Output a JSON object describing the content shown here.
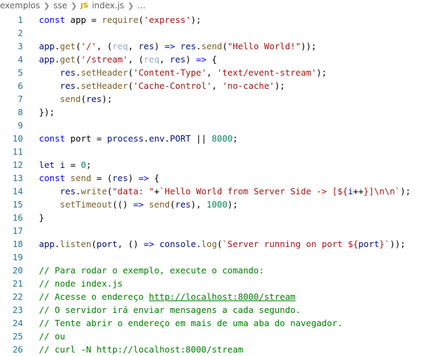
{
  "breadcrumb": {
    "items": [
      "exemplos",
      "sse",
      "index.js",
      "..."
    ],
    "file_icon": "JS"
  },
  "lines": [
    {
      "n": "1",
      "tokens": [
        {
          "t": "const",
          "c": "kw"
        },
        {
          "t": " app = ",
          "c": "plain"
        },
        {
          "t": "require",
          "c": "fn"
        },
        {
          "t": "(",
          "c": "plain"
        },
        {
          "t": "'express'",
          "c": "str"
        },
        {
          "t": ");",
          "c": "plain"
        }
      ]
    },
    {
      "n": "2",
      "tokens": []
    },
    {
      "n": "3",
      "tokens": [
        {
          "t": "app",
          "c": "var"
        },
        {
          "t": ".",
          "c": "plain"
        },
        {
          "t": "get",
          "c": "fn"
        },
        {
          "t": "(",
          "c": "plain"
        },
        {
          "t": "'/'",
          "c": "str"
        },
        {
          "t": ", (",
          "c": "plain"
        },
        {
          "t": "req",
          "c": "unused"
        },
        {
          "t": ", ",
          "c": "plain"
        },
        {
          "t": "res",
          "c": "param"
        },
        {
          "t": ") ",
          "c": "plain"
        },
        {
          "t": "=>",
          "c": "kw"
        },
        {
          "t": " ",
          "c": "plain"
        },
        {
          "t": "res",
          "c": "param"
        },
        {
          "t": ".",
          "c": "plain"
        },
        {
          "t": "send",
          "c": "fn"
        },
        {
          "t": "(",
          "c": "plain"
        },
        {
          "t": "\"Hello World!\"",
          "c": "str"
        },
        {
          "t": "));",
          "c": "plain"
        }
      ]
    },
    {
      "n": "4",
      "tokens": [
        {
          "t": "app",
          "c": "var"
        },
        {
          "t": ".",
          "c": "plain"
        },
        {
          "t": "get",
          "c": "fn"
        },
        {
          "t": "(",
          "c": "plain"
        },
        {
          "t": "'/stream'",
          "c": "str"
        },
        {
          "t": ", (",
          "c": "plain"
        },
        {
          "t": "req",
          "c": "unused"
        },
        {
          "t": ", ",
          "c": "plain"
        },
        {
          "t": "res",
          "c": "param"
        },
        {
          "t": ") ",
          "c": "plain"
        },
        {
          "t": "=>",
          "c": "kw"
        },
        {
          "t": " {",
          "c": "plain"
        }
      ]
    },
    {
      "n": "5",
      "tokens": [
        {
          "t": "    ",
          "c": "plain"
        },
        {
          "t": "res",
          "c": "param"
        },
        {
          "t": ".",
          "c": "plain"
        },
        {
          "t": "setHeader",
          "c": "fn"
        },
        {
          "t": "(",
          "c": "plain"
        },
        {
          "t": "'Content-Type'",
          "c": "str"
        },
        {
          "t": ", ",
          "c": "plain"
        },
        {
          "t": "'text/event-stream'",
          "c": "str"
        },
        {
          "t": ");",
          "c": "plain"
        }
      ]
    },
    {
      "n": "6",
      "tokens": [
        {
          "t": "    ",
          "c": "plain"
        },
        {
          "t": "res",
          "c": "param"
        },
        {
          "t": ".",
          "c": "plain"
        },
        {
          "t": "setHeader",
          "c": "fn"
        },
        {
          "t": "(",
          "c": "plain"
        },
        {
          "t": "'Cache-Control'",
          "c": "str"
        },
        {
          "t": ", ",
          "c": "plain"
        },
        {
          "t": "'no-cache'",
          "c": "str"
        },
        {
          "t": ");",
          "c": "plain"
        }
      ]
    },
    {
      "n": "7",
      "tokens": [
        {
          "t": "    ",
          "c": "plain"
        },
        {
          "t": "send",
          "c": "fn"
        },
        {
          "t": "(",
          "c": "plain"
        },
        {
          "t": "res",
          "c": "param"
        },
        {
          "t": ");",
          "c": "plain"
        }
      ]
    },
    {
      "n": "8",
      "tokens": [
        {
          "t": "});",
          "c": "plain"
        }
      ]
    },
    {
      "n": "9",
      "tokens": []
    },
    {
      "n": "10",
      "tokens": [
        {
          "t": "const",
          "c": "kw"
        },
        {
          "t": " port = ",
          "c": "plain"
        },
        {
          "t": "process",
          "c": "var"
        },
        {
          "t": ".",
          "c": "plain"
        },
        {
          "t": "env",
          "c": "var"
        },
        {
          "t": ".",
          "c": "plain"
        },
        {
          "t": "PORT",
          "c": "var"
        },
        {
          "t": " || ",
          "c": "plain"
        },
        {
          "t": "8000",
          "c": "num"
        },
        {
          "t": ";",
          "c": "plain"
        }
      ]
    },
    {
      "n": "11",
      "tokens": []
    },
    {
      "n": "12",
      "tokens": [
        {
          "t": "let",
          "c": "kw"
        },
        {
          "t": " ",
          "c": "plain"
        },
        {
          "t": "i",
          "c": "var"
        },
        {
          "t": " = ",
          "c": "plain"
        },
        {
          "t": "0",
          "c": "num"
        },
        {
          "t": ";",
          "c": "plain"
        }
      ]
    },
    {
      "n": "13",
      "tokens": [
        {
          "t": "const",
          "c": "kw"
        },
        {
          "t": " ",
          "c": "plain"
        },
        {
          "t": "send",
          "c": "fn"
        },
        {
          "t": " = (",
          "c": "plain"
        },
        {
          "t": "res",
          "c": "param"
        },
        {
          "t": ") ",
          "c": "plain"
        },
        {
          "t": "=>",
          "c": "kw"
        },
        {
          "t": " {",
          "c": "plain"
        }
      ]
    },
    {
      "n": "14",
      "tokens": [
        {
          "t": "    ",
          "c": "plain"
        },
        {
          "t": "res",
          "c": "param"
        },
        {
          "t": ".",
          "c": "plain"
        },
        {
          "t": "write",
          "c": "fn"
        },
        {
          "t": "(",
          "c": "plain"
        },
        {
          "t": "\"data: \"",
          "c": "str"
        },
        {
          "t": "+",
          "c": "plain"
        },
        {
          "t": "`Hello World from Server Side -> [${",
          "c": "str"
        },
        {
          "t": "i",
          "c": "var"
        },
        {
          "t": "++",
          "c": "plain"
        },
        {
          "t": "}]\\n\\n`",
          "c": "str"
        },
        {
          "t": ");",
          "c": "plain"
        }
      ]
    },
    {
      "n": "15",
      "tokens": [
        {
          "t": "    ",
          "c": "plain"
        },
        {
          "t": "setTimeout",
          "c": "fn"
        },
        {
          "t": "(() ",
          "c": "plain"
        },
        {
          "t": "=>",
          "c": "kw"
        },
        {
          "t": " ",
          "c": "plain"
        },
        {
          "t": "send",
          "c": "fn"
        },
        {
          "t": "(",
          "c": "plain"
        },
        {
          "t": "res",
          "c": "param"
        },
        {
          "t": "), ",
          "c": "plain"
        },
        {
          "t": "1000",
          "c": "num"
        },
        {
          "t": ");",
          "c": "plain"
        }
      ]
    },
    {
      "n": "16",
      "tokens": [
        {
          "t": "}",
          "c": "plain"
        }
      ]
    },
    {
      "n": "17",
      "tokens": []
    },
    {
      "n": "18",
      "tokens": [
        {
          "t": "app",
          "c": "var"
        },
        {
          "t": ".",
          "c": "plain"
        },
        {
          "t": "listen",
          "c": "fn"
        },
        {
          "t": "(",
          "c": "plain"
        },
        {
          "t": "port",
          "c": "var"
        },
        {
          "t": ", () ",
          "c": "plain"
        },
        {
          "t": "=>",
          "c": "kw"
        },
        {
          "t": " ",
          "c": "plain"
        },
        {
          "t": "console",
          "c": "var"
        },
        {
          "t": ".",
          "c": "plain"
        },
        {
          "t": "log",
          "c": "fn"
        },
        {
          "t": "(",
          "c": "plain"
        },
        {
          "t": "`Server running on port ${",
          "c": "str"
        },
        {
          "t": "port",
          "c": "var"
        },
        {
          "t": "}`",
          "c": "str"
        },
        {
          "t": "));",
          "c": "plain"
        }
      ]
    },
    {
      "n": "19",
      "tokens": []
    },
    {
      "n": "20",
      "tokens": [
        {
          "t": "// Para rodar o exemplo, execute o comando:",
          "c": "cmt"
        }
      ]
    },
    {
      "n": "21",
      "tokens": [
        {
          "t": "// node index.js",
          "c": "cmt"
        }
      ]
    },
    {
      "n": "22",
      "tokens": [
        {
          "t": "// Acesse o endereço ",
          "c": "cmt"
        },
        {
          "t": "http://localhost:8000/stream",
          "c": "url"
        }
      ]
    },
    {
      "n": "23",
      "tokens": [
        {
          "t": "// O servidor irá enviar mensagens a cada segundo.",
          "c": "cmt"
        }
      ]
    },
    {
      "n": "24",
      "tokens": [
        {
          "t": "// Tente abrir o endereço em mais de uma aba do navegador.",
          "c": "cmt"
        }
      ]
    },
    {
      "n": "25",
      "tokens": [
        {
          "t": "// ou",
          "c": "cmt"
        }
      ]
    },
    {
      "n": "26",
      "tokens": [
        {
          "t": "// curl -N http://localhost:8000/stream",
          "c": "cmt"
        }
      ]
    }
  ],
  "colors": {
    "keyword": "#0000ff",
    "string": "#a31515",
    "number": "#098658",
    "variable": "#001080",
    "function": "#795e26",
    "comment": "#008000",
    "line_number": "#237893"
  }
}
